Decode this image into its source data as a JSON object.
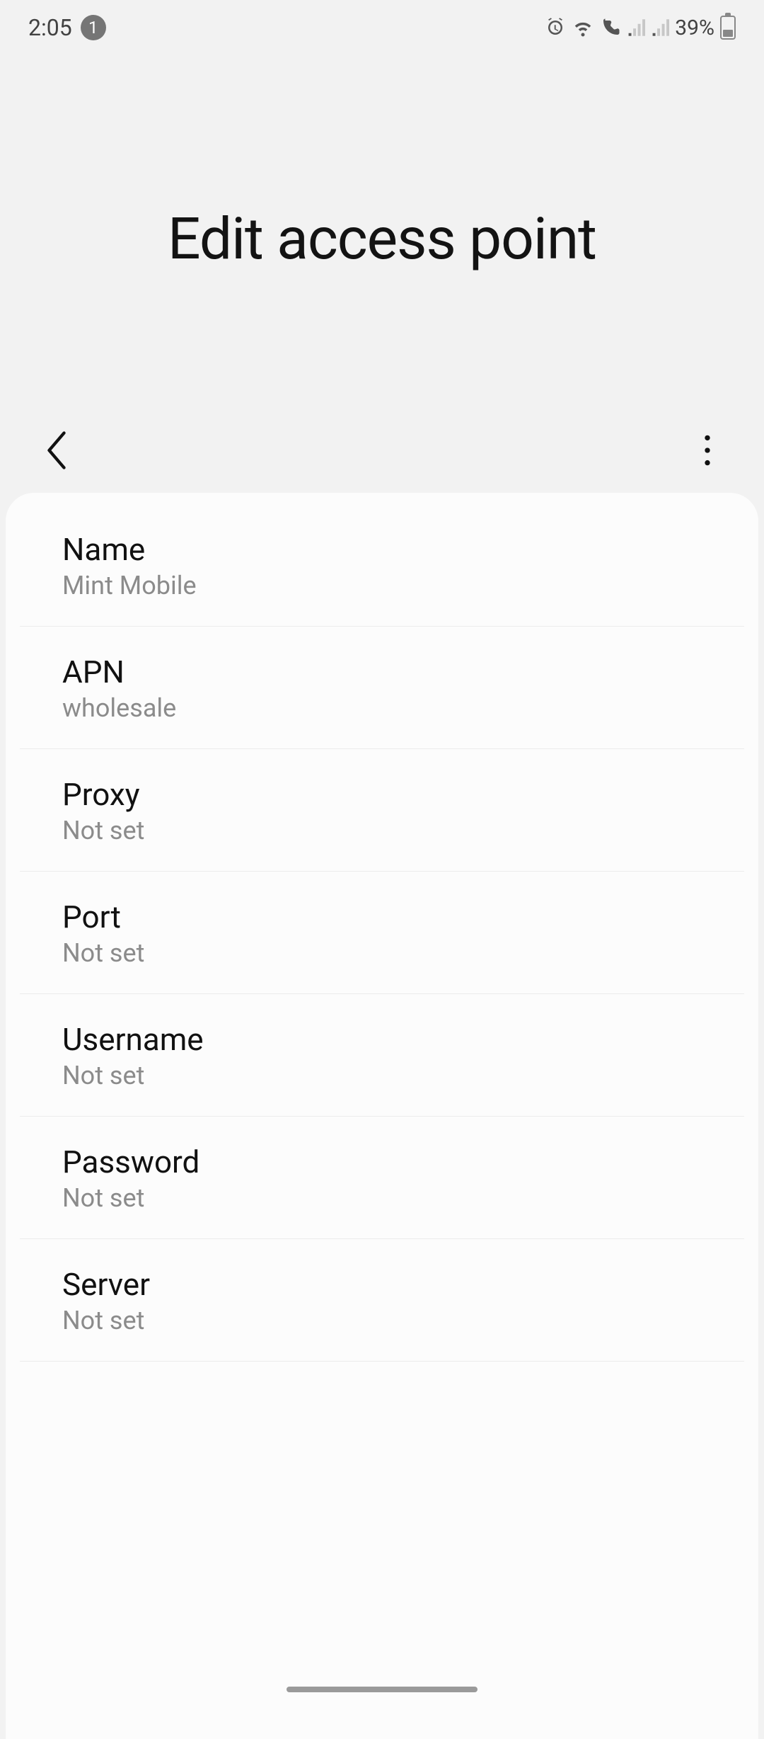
{
  "statusbar": {
    "time": "2:05",
    "notification_count": "1",
    "battery_percent": "39%"
  },
  "header": {
    "title": "Edit access point"
  },
  "settings": [
    {
      "label": "Name",
      "value": "Mint Mobile"
    },
    {
      "label": "APN",
      "value": "wholesale"
    },
    {
      "label": "Proxy",
      "value": "Not set"
    },
    {
      "label": "Port",
      "value": "Not set"
    },
    {
      "label": "Username",
      "value": "Not set"
    },
    {
      "label": "Password",
      "value": "Not set"
    },
    {
      "label": "Server",
      "value": "Not set"
    }
  ]
}
